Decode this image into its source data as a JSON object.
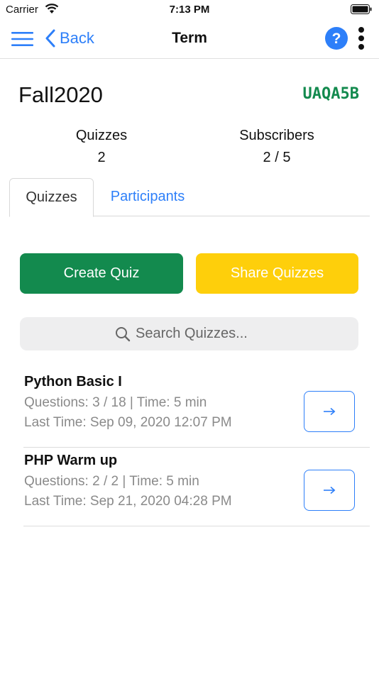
{
  "status_bar": {
    "carrier": "Carrier",
    "time": "7:13 PM"
  },
  "nav": {
    "back_label": "Back",
    "title": "Term"
  },
  "term": {
    "name": "Fall2020",
    "code": "UAQA5B"
  },
  "stats": {
    "quizzes": {
      "label": "Quizzes",
      "value": "2"
    },
    "subscribers": {
      "label": "Subscribers",
      "value": "2 / 5"
    }
  },
  "tabs": [
    {
      "label": "Quizzes",
      "active": true
    },
    {
      "label": "Participants",
      "active": false
    }
  ],
  "actions": {
    "create_label": "Create Quiz",
    "share_label": "Share Quizzes"
  },
  "search": {
    "placeholder": "Search Quizzes..."
  },
  "quizzes": [
    {
      "title": "Python Basic I",
      "meta": "Questions: 3 / 18 | Time: 5 min",
      "last_time": "Last Time: Sep 09, 2020 12:07 PM"
    },
    {
      "title": "PHP Warm up",
      "meta": "Questions: 2 / 2 | Time: 5 min",
      "last_time": "Last Time: Sep 21, 2020 04:28 PM"
    }
  ],
  "colors": {
    "accent": "#2d7ff9",
    "primary_green": "#138a4e",
    "share_yellow": "#fecf0b",
    "muted": "#8a8a8a"
  },
  "icons": [
    "wifi-icon",
    "battery-icon",
    "menu-icon",
    "chevron-left-icon",
    "help-icon",
    "more-vertical-icon",
    "search-icon",
    "arrow-right-icon"
  ]
}
